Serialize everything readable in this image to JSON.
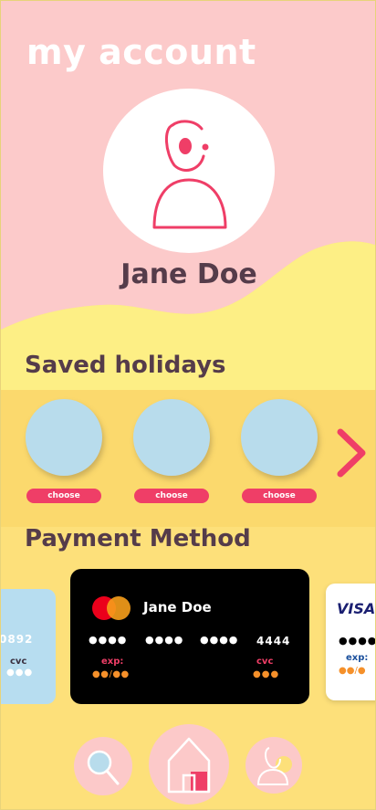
{
  "header": {
    "title": "my account"
  },
  "profile": {
    "name": "Jane Doe"
  },
  "holidays": {
    "title": "Saved holidays",
    "items": [
      {
        "button_label": "choose"
      },
      {
        "button_label": "choose"
      },
      {
        "button_label": "choose"
      }
    ]
  },
  "payment": {
    "title": "Payment Method",
    "cards": {
      "left": {
        "digits": "0892",
        "cvc_label": "cvc",
        "cvc_mask": "●●●"
      },
      "main": {
        "holder": "Jane Doe",
        "groups": [
          "●●●●",
          "●●●●",
          "●●●●",
          "4444"
        ],
        "exp_label": "exp:",
        "exp_mask": "●●/●●",
        "cvc_label": "cvc",
        "cvc_mask": "●●●"
      },
      "right": {
        "brand": "VISA",
        "digits_mask": "●●●●",
        "exp_label": "exp:",
        "exp_mask": "●●/●"
      }
    }
  },
  "colors": {
    "pink_bg": "#fccaca",
    "yellow_wave": "#fdef85",
    "band_yellow": "#fbd96d",
    "accent_red": "#ef3e67",
    "dark_text": "#553c4a",
    "bubble_blue": "#b8dcec",
    "orange_dots": "#f5902a"
  },
  "nav": {
    "items": [
      {
        "icon": "magnifier-icon"
      },
      {
        "icon": "home-icon"
      },
      {
        "icon": "profile-icon"
      }
    ]
  }
}
